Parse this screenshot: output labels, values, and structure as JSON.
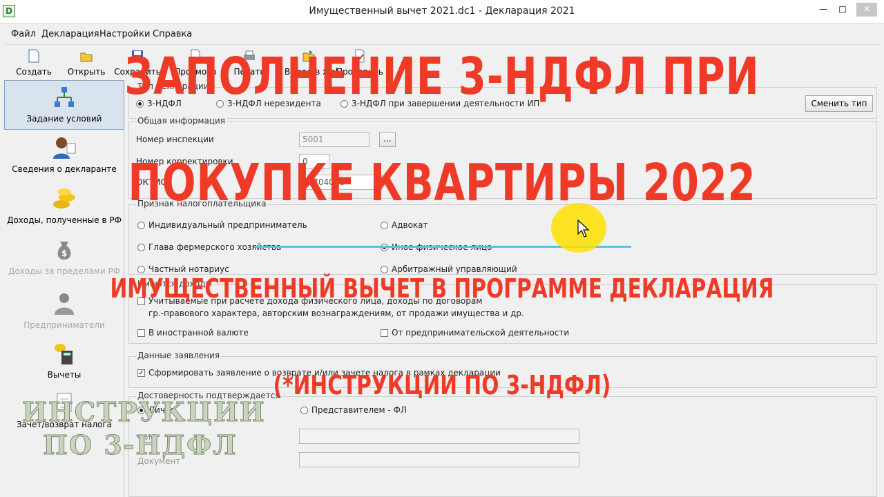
{
  "window": {
    "title": "Имущественный вычет 2021.dc1 - Декларация 2021",
    "icon_letter": "D",
    "minimize_glyph": "—",
    "maximize_glyph": "□",
    "close_glyph": "✕"
  },
  "menu": [
    "Файл",
    "Декларация",
    "Настройки",
    "Справка"
  ],
  "toolbar": [
    {
      "label": "Создать",
      "icon": "new-file-icon"
    },
    {
      "label": "Открыть",
      "icon": "open-folder-icon"
    },
    {
      "label": "Сохранить",
      "icon": "save-icon"
    },
    {
      "label": "Просмотр",
      "icon": "preview-icon"
    },
    {
      "label": "Печать",
      "icon": "print-icon"
    },
    {
      "label": "Вывод в xml",
      "icon": "export-xml-icon"
    },
    {
      "label": "Проверить",
      "icon": "check-icon"
    }
  ],
  "sidebar": [
    {
      "label": "Задание условий",
      "icon": "conditions-icon",
      "active": true,
      "disabled": false
    },
    {
      "label": "Сведения о декларанте",
      "icon": "person-icon",
      "active": false,
      "disabled": false
    },
    {
      "label": "Доходы, полученные в РФ",
      "icon": "coins-icon",
      "active": false,
      "disabled": false
    },
    {
      "label": "Доходы за пределами РФ",
      "icon": "money-bag-icon",
      "active": false,
      "disabled": true
    },
    {
      "label": "Предприниматели",
      "icon": "entrepreneur-icon",
      "active": false,
      "disabled": true
    },
    {
      "label": "Вычеты",
      "icon": "calculator-icon",
      "active": false,
      "disabled": false
    },
    {
      "label": "Зачет/возврат налога",
      "icon": "refund-icon",
      "active": false,
      "disabled": false
    }
  ],
  "declaration_type": {
    "title": "Тип декларации",
    "options": [
      "3-НДФЛ",
      "3-НДФЛ нерезидента",
      "3-НДФЛ при завершении деятельности ИП"
    ],
    "selected": 0,
    "change_button": "Сменить тип"
  },
  "general": {
    "title": "Общая информация",
    "inspection_label": "Номер инспекции",
    "inspection_value": "5001",
    "inspection_button": "...",
    "correction_label": "Номер корректировки",
    "correction_value": "0",
    "oktmo_label": "ОКТМО",
    "oktmo_value": "46704000"
  },
  "taxpayer": {
    "title": "Признак налогоплательщика",
    "options_left": [
      "Индивидуальный предприниматель",
      "Глава фермерского хозяйства",
      "Частный нотариус"
    ],
    "options_right": [
      "Адвокат",
      "Иное физическое лицо",
      "Арбитражный управляющий"
    ],
    "selected_right": 1
  },
  "income": {
    "title": "Имеются доходы",
    "line1": "Учитываемые при расчете дохода физического лица, доходы по договорам",
    "line2": "гр.-правового характера, авторским вознаграждениям, от продажи имущества и др.",
    "foreign": "В иностранной валюте",
    "business": "От предпринимательской деятельности"
  },
  "application": {
    "title": "Данные заявления",
    "checkbox": "Сформировать заявление о возврате и/или зачете налога в рамках декларации",
    "checked": true
  },
  "reliability": {
    "title": "Достоверность подтверждается",
    "personal": "Лично",
    "representative": "Представителем - ФЛ",
    "fio_label": "ФИО",
    "document_label": "Документ"
  },
  "overlay": {
    "headline_line1": "ЗАПОЛНЕНИЕ 3-НДФЛ ПРИ",
    "headline_line2": "ПОКУПКЕ КВАРТИРЫ 2022",
    "subtitle": "ИМУЩЕСТВЕННЫЙ ВЫЧЕТ В ПРОГРАММЕ ДЕКЛАРАЦИЯ",
    "caption": "(*ИНСТРУКЦИИ ПО 3-НДФЛ)",
    "watermark_line1": "ИНСТРУКЦИИ",
    "watermark_line2": "ПО 3-НДФЛ"
  },
  "colors": {
    "overlay_red": "#ee3a26",
    "highlight_yellow": "#ffe100",
    "underline_cyan": "#59c3e0",
    "active_sidebar": "#d9e3ee"
  }
}
